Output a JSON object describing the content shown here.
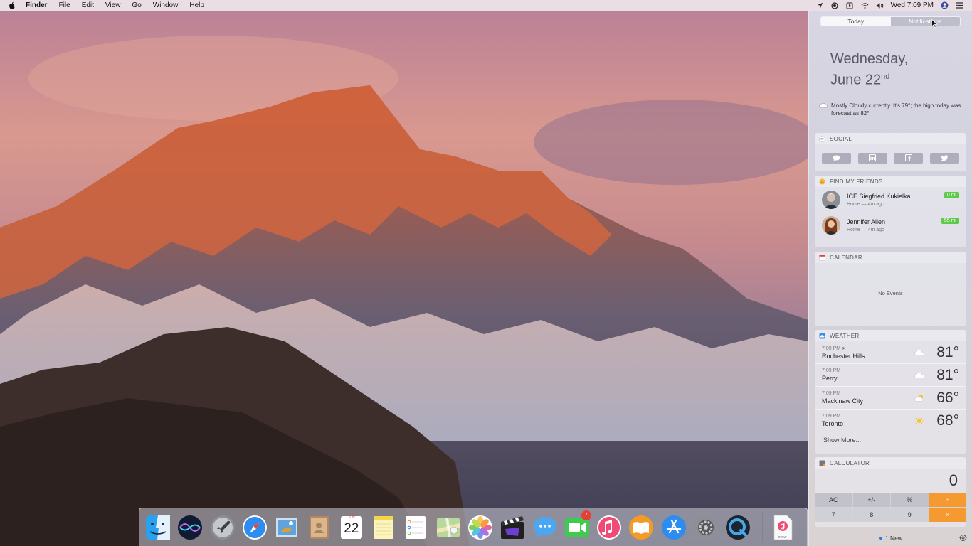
{
  "menubar": {
    "app_name": "Finder",
    "menus": [
      "File",
      "Edit",
      "View",
      "Go",
      "Window",
      "Help"
    ],
    "clock": "Wed 7:09 PM",
    "status_icons": [
      "location-icon",
      "record-icon",
      "play-icon",
      "wifi-icon",
      "volume-icon",
      "user-icon",
      "notification-list-icon"
    ]
  },
  "notification_center": {
    "tabs": [
      {
        "label": "Today",
        "active": true
      },
      {
        "label": "Notifications",
        "active": false
      }
    ],
    "date_line1": "Wednesday,",
    "date_line2": "June 22",
    "date_suffix": "nd",
    "forecast": "Mostly Cloudy currently. It's 79°; the high today was forecast as 82°.",
    "social": {
      "title": "SOCIAL",
      "buttons": [
        "messages-icon",
        "linkedin-icon",
        "facebook-icon",
        "twitter-icon"
      ]
    },
    "find_my_friends": {
      "title": "FIND MY FRIENDS",
      "friends": [
        {
          "name": "ICE Siegfried Kukielka",
          "location": "Home",
          "time": "4m ago",
          "distance": "0 mi"
        },
        {
          "name": "Jennifer Allen",
          "location": "Home",
          "time": "4m ago",
          "distance": "55 mi"
        }
      ]
    },
    "calendar": {
      "title": "CALENDAR",
      "empty_text": "No Events"
    },
    "weather": {
      "title": "WEATHER",
      "rows": [
        {
          "time": "7:09 PM",
          "city": "Rochester Hills",
          "temp": "81°",
          "icon": "cloud-icon"
        },
        {
          "time": "7:09 PM",
          "city": "Perry",
          "temp": "81°",
          "icon": "cloud-icon"
        },
        {
          "time": "7:09 PM",
          "city": "Mackinaw City",
          "temp": "66°",
          "icon": "partly-sunny-icon"
        },
        {
          "time": "7:09 PM",
          "city": "Toronto",
          "temp": "68°",
          "icon": "sun-icon"
        }
      ],
      "show_more": "Show More..."
    },
    "calculator": {
      "title": "CALCULATOR",
      "display": "0",
      "keys": [
        "AC",
        "+/-",
        "%",
        "÷",
        "7",
        "8",
        "9",
        "×"
      ]
    },
    "footer": {
      "new_label": "1 New"
    }
  },
  "dock": {
    "apps": [
      "finder-icon",
      "siri-icon",
      "launchpad-icon",
      "safari-icon",
      "mail-icon",
      "contacts-icon",
      "calendar-icon",
      "notes-icon",
      "reminders-icon",
      "maps-icon",
      "photos-icon",
      "final-cut-icon",
      "messages-icon",
      "facetime-icon",
      "itunes-icon",
      "ibooks-icon",
      "app-store-icon",
      "system-preferences-icon",
      "quicktime-icon"
    ],
    "calendar_month": "JUN",
    "calendar_day": "22",
    "facetime_badge": "7",
    "doc_label": "IPSW"
  },
  "colors": {
    "accent_orange": "#f49a30",
    "distance_green": "#5fc94a",
    "badge_red": "#e64034"
  }
}
